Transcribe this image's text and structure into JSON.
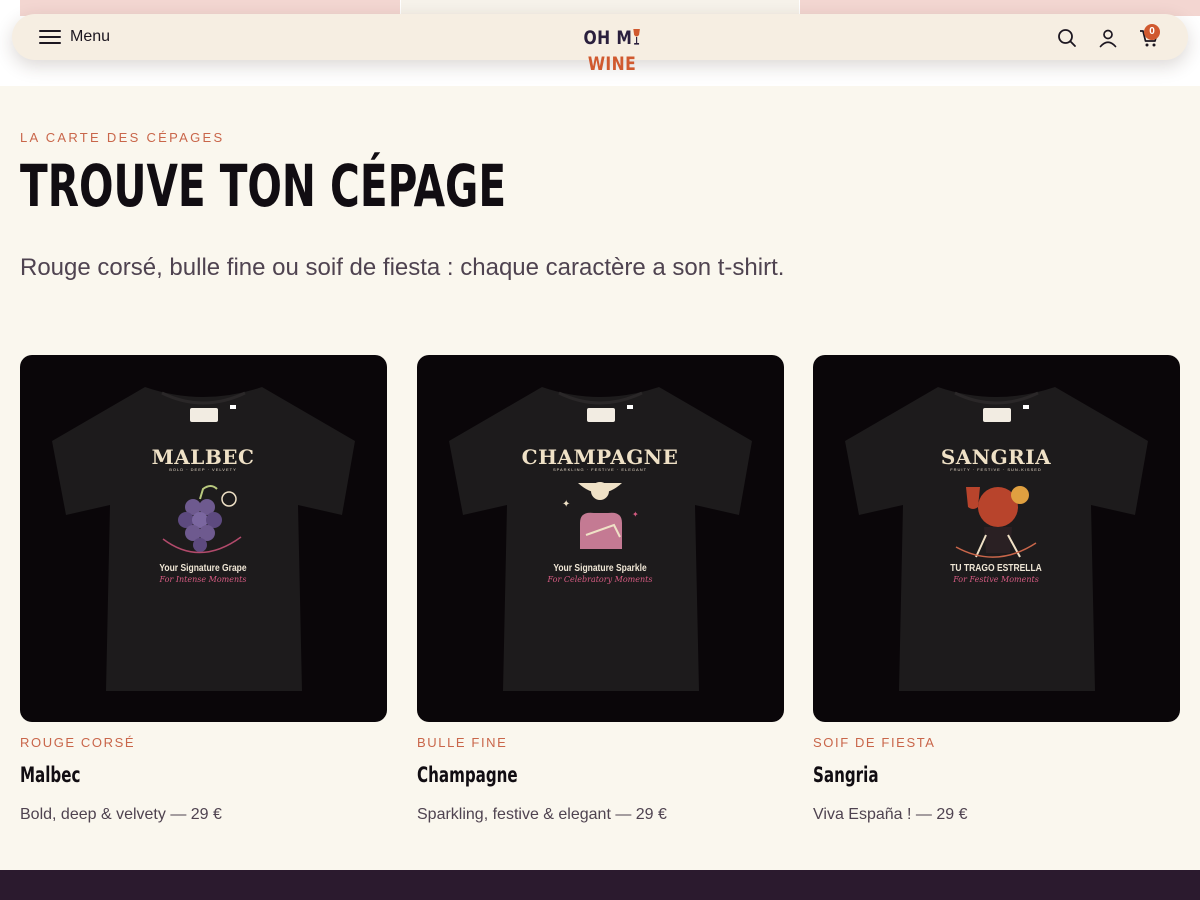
{
  "header": {
    "menu_label": "Menu",
    "logo_part1": "OH M",
    "logo_glass": "🍷",
    "logo_part2": "WINE",
    "cart_count": "0"
  },
  "section": {
    "eyebrow": "LA CARTE DES CÉPAGES",
    "title": "TROUVE TON CÉPAGE",
    "intro": "Rouge corsé, bulle fine ou soif de fiesta : chaque caractère a son t-shirt."
  },
  "products": [
    {
      "category": "ROUGE CORSÉ",
      "name": "Malbec",
      "description": "Bold, deep & velvety — 29 €",
      "design_title": "MALBEC",
      "design_subtitle": "BOLD · DEEP · VELVETY",
      "design_tagline": "Your Signature Grape",
      "design_tagline2": "For Intense Moments"
    },
    {
      "category": "BULLE FINE",
      "name": "Champagne",
      "description": "Sparkling, festive & elegant — 29 €",
      "design_title": "CHAMPAGNE",
      "design_subtitle": "SPARKLING · FESTIVE · ELEGANT",
      "design_tagline": "Your Signature Sparkle",
      "design_tagline2": "For Celebratory Moments"
    },
    {
      "category": "SOIF DE FIESTA",
      "name": "Sangria",
      "description": "Viva España ! — 29 €",
      "design_title": "SANGRIA",
      "design_subtitle": "FRUITY · FESTIVE · SUN-KISSED",
      "design_tagline": "TU TRAGO ESTRELLA",
      "design_tagline2": "For Festive Moments"
    }
  ],
  "colors": {
    "background": "#faf7ee",
    "accent": "#d0592f",
    "eyebrow": "#c9664a",
    "brand_dark": "#2a1f3d",
    "card_bg": "#0a0609",
    "footer": "#2b1a2e"
  }
}
